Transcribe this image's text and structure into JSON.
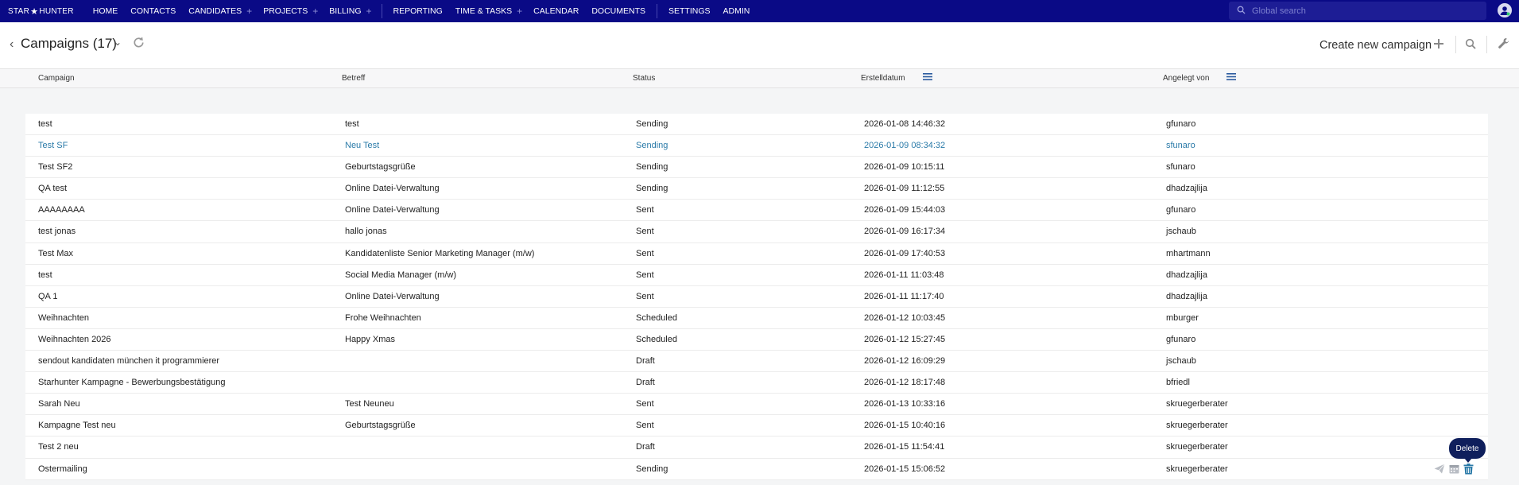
{
  "app": {
    "logo_left": "STAR",
    "logo_right": "HUNTER"
  },
  "nav": {
    "items": [
      {
        "label": "HOME",
        "plus": false
      },
      {
        "label": "CONTACTS",
        "plus": false
      },
      {
        "label": "CANDIDATES",
        "plus": true
      },
      {
        "label": "PROJECTS",
        "plus": true
      },
      {
        "label": "BILLING",
        "plus": true
      },
      {
        "label": "REPORTING",
        "plus": false
      },
      {
        "label": "TIME & TASKS",
        "plus": true
      },
      {
        "label": "CALENDAR",
        "plus": false
      },
      {
        "label": "DOCUMENTS",
        "plus": false
      },
      {
        "label": "SETTINGS",
        "plus": false
      },
      {
        "label": "ADMIN",
        "plus": false
      }
    ],
    "search_placeholder": "Global search"
  },
  "page": {
    "title": "Campaigns (17)",
    "create_label": "Create new campaign"
  },
  "columns": {
    "campaign": "Campaign",
    "subject": "Betreff",
    "status": "Status",
    "created": "Erstelldatum",
    "created_by": "Angelegt von"
  },
  "rows": [
    {
      "campaign": "test",
      "subject": "test",
      "status": "Sending",
      "created": "2026-01-08 14:46:32",
      "by": "gfunaro"
    },
    {
      "campaign": "Test SF",
      "subject": "Neu Test",
      "status": "Sending",
      "created": "2026-01-09 08:34:32",
      "by": "sfunaro"
    },
    {
      "campaign": "Test SF2",
      "subject": "Geburtstagsgrüße",
      "status": "Sending",
      "created": "2026-01-09 10:15:11",
      "by": "sfunaro"
    },
    {
      "campaign": "QA test",
      "subject": "Online Datei-Verwaltung",
      "status": "Sending",
      "created": "2026-01-09 11:12:55",
      "by": "dhadzajlija"
    },
    {
      "campaign": "AAAAAAAA",
      "subject": "Online Datei-Verwaltung",
      "status": "Sent",
      "created": "2026-01-09 15:44:03",
      "by": "gfunaro"
    },
    {
      "campaign": "test jonas",
      "subject": "hallo jonas",
      "status": "Sent",
      "created": "2026-01-09 16:17:34",
      "by": "jschaub"
    },
    {
      "campaign": "Test Max",
      "subject": "Kandidatenliste Senior Marketing Manager (m/w)",
      "status": "Sent",
      "created": "2026-01-09 17:40:53",
      "by": "mhartmann"
    },
    {
      "campaign": "test",
      "subject": "Social Media Manager (m/w)",
      "status": "Sent",
      "created": "2026-01-11 11:03:48",
      "by": "dhadzajlija"
    },
    {
      "campaign": "QA 1",
      "subject": "Online Datei-Verwaltung",
      "status": "Sent",
      "created": "2026-01-11 11:17:40",
      "by": "dhadzajlija"
    },
    {
      "campaign": "Weihnachten",
      "subject": "Frohe Weihnachten",
      "status": "Scheduled",
      "created": "2026-01-12 10:03:45",
      "by": "mburger"
    },
    {
      "campaign": "Weihnachten 2026",
      "subject": "Happy Xmas",
      "status": "Scheduled",
      "created": "2026-01-12 15:27:45",
      "by": "gfunaro"
    },
    {
      "campaign": "sendout kandidaten münchen it programmierer",
      "subject": "",
      "status": "Draft",
      "created": "2026-01-12 16:09:29",
      "by": "jschaub"
    },
    {
      "campaign": "Starhunter Kampagne - Bewerbungsbestätigung",
      "subject": "",
      "status": "Draft",
      "created": "2026-01-12 18:17:48",
      "by": "bfriedl"
    },
    {
      "campaign": "Sarah Neu",
      "subject": "Test Neuneu",
      "status": "Sent",
      "created": "2026-01-13 10:33:16",
      "by": "skruegerberater"
    },
    {
      "campaign": "Kampagne Test neu",
      "subject": "Geburtstagsgrüße",
      "status": "Sent",
      "created": "2026-01-15 10:40:16",
      "by": "skruegerberater"
    },
    {
      "campaign": "Test 2 neu",
      "subject": "",
      "status": "Draft",
      "created": "2026-01-15 11:54:41",
      "by": "skruegerberater"
    },
    {
      "campaign": "Ostermailing",
      "subject": "",
      "status": "Sending",
      "created": "2026-01-15 15:06:52",
      "by": "skruegerberater"
    }
  ],
  "highlight_row": 1,
  "hover_row": 16,
  "tooltip": "Delete",
  "colors": {
    "nav_bg": "#0a0a86",
    "link": "#2a7aa8",
    "delete": "#2a7aa8"
  }
}
